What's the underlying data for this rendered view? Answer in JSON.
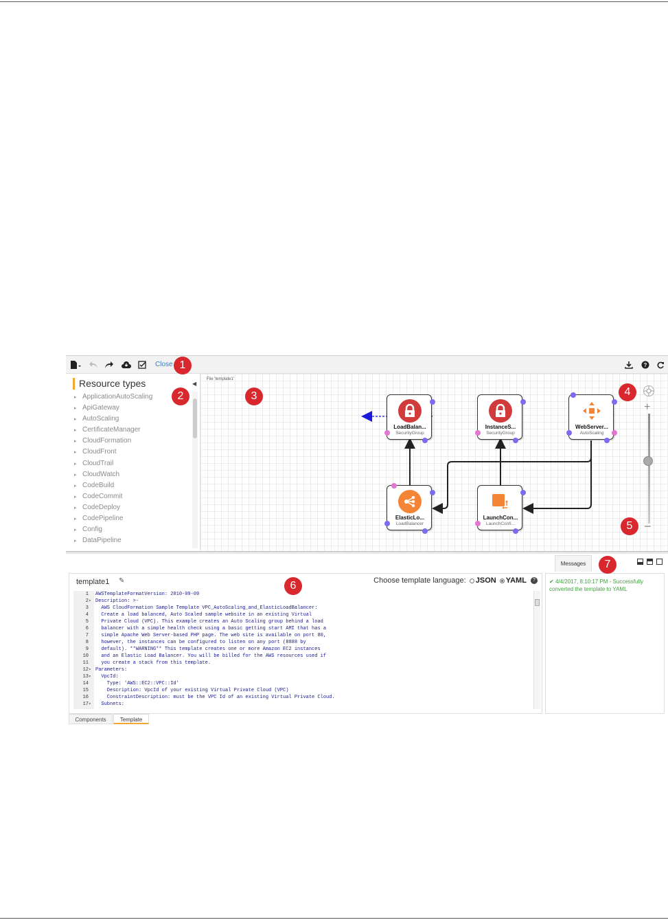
{
  "toolbar": {
    "close_label": "Close",
    "icons": [
      "file-menu-icon",
      "undo-icon",
      "redo-icon",
      "save-cloud-icon",
      "validate-icon",
      "download-icon",
      "help-icon",
      "refresh-icon"
    ]
  },
  "callouts": [
    "1",
    "2",
    "3",
    "4",
    "5",
    "6",
    "7"
  ],
  "resource_panel": {
    "title": "Resource types",
    "items": [
      "ApplicationAutoScaling",
      "ApiGateway",
      "AutoScaling",
      "CertificateManager",
      "CloudFormation",
      "CloudFront",
      "CloudTrail",
      "CloudWatch",
      "CodeBuild",
      "CodeCommit",
      "CodeDeploy",
      "CodePipeline",
      "Config",
      "DataPipeline"
    ]
  },
  "canvas": {
    "file_label": "File 'template1'",
    "nodes": [
      {
        "title": "LoadBalan...",
        "type": "SecurityGroup",
        "icon": "lock-icon",
        "color": "#d13b3b"
      },
      {
        "title": "InstanceS...",
        "type": "SecurityGroup",
        "icon": "lock-icon",
        "color": "#d13b3b"
      },
      {
        "title": "WebServer...",
        "type": "AutoScaling",
        "icon": "autoscaling-icon",
        "color": "#f58536"
      },
      {
        "title": "ElasticLo...",
        "type": "LoadBalancer",
        "icon": "load-balancer-icon",
        "color": "#f58536"
      },
      {
        "title": "LaunchCon...",
        "type": "LaunchConfi...",
        "icon": "launch-config-icon",
        "color": "#f58536"
      }
    ]
  },
  "editor": {
    "template_name": "template1",
    "language_prompt": "Choose template language:",
    "options": [
      "JSON",
      "YAML"
    ],
    "selected": "YAML",
    "lines": [
      {
        "n": "1",
        "fold": "",
        "text": "AWSTemplateFormatVersion: 2010-09-09"
      },
      {
        "n": "2",
        "fold": "▾",
        "text": "Description: >-"
      },
      {
        "n": "3",
        "fold": "",
        "text": "  AWS CloudFormation Sample Template VPC_AutoScaling_and_ElasticLoadBalancer:"
      },
      {
        "n": "4",
        "fold": "",
        "text": "  Create a load balanced, Auto Scaled sample website in an existing Virtual"
      },
      {
        "n": "5",
        "fold": "",
        "text": "  Private Cloud (VPC). This example creates an Auto Scaling group behind a load"
      },
      {
        "n": "6",
        "fold": "",
        "text": "  balancer with a simple health check using a basic getting start AMI that has a"
      },
      {
        "n": "7",
        "fold": "",
        "text": "  simple Apache Web Server-based PHP page. The web site is available on port 80,"
      },
      {
        "n": "8",
        "fold": "",
        "text": "  however, the instances can be configured to listen on any port (8888 by"
      },
      {
        "n": "9",
        "fold": "",
        "text": "  default). **WARNING** This template creates one or more Amazon EC2 instances"
      },
      {
        "n": "10",
        "fold": "",
        "text": "  and an Elastic Load Balancer. You will be billed for the AWS resources used if"
      },
      {
        "n": "11",
        "fold": "",
        "text": "  you create a stack from this template."
      },
      {
        "n": "12",
        "fold": "▾",
        "text": "Parameters:"
      },
      {
        "n": "13",
        "fold": "▾",
        "text": "  VpcId:"
      },
      {
        "n": "14",
        "fold": "",
        "text": "    Type: 'AWS::EC2::VPC::Id'"
      },
      {
        "n": "15",
        "fold": "",
        "text": "    Description: VpcId of your existing Virtual Private Cloud (VPC)"
      },
      {
        "n": "16",
        "fold": "",
        "text": "    ConstraintDescription: must be the VPC Id of an existing Virtual Private Cloud."
      },
      {
        "n": "17",
        "fold": "▾",
        "text": "  Subnets:"
      }
    ]
  },
  "bottom_tabs": [
    "Components",
    "Template"
  ],
  "messages": {
    "tab_label": "Messages",
    "text": "4/4/2017, 8:10:17 PM - Successfully converted the template to YAML",
    "color": "#3ca43c"
  }
}
